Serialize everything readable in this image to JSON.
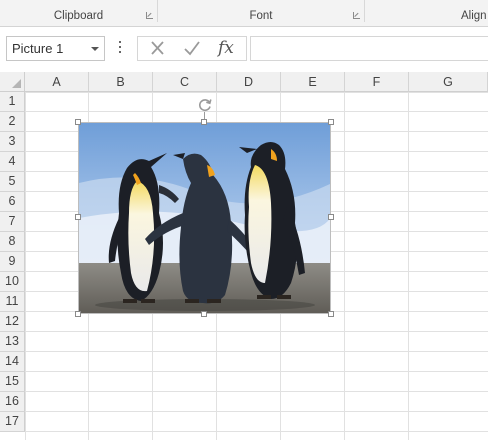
{
  "ribbon": {
    "groups": [
      {
        "label": "Clipboard"
      },
      {
        "label": "Font"
      },
      {
        "label": "Align"
      }
    ]
  },
  "formula_bar": {
    "name_box_value": "Picture 1",
    "cancel_icon": "close-icon",
    "enter_icon": "check-icon",
    "function_label": "fx",
    "formula_value": ""
  },
  "sheet": {
    "columns": [
      "A",
      "B",
      "C",
      "D",
      "E",
      "F",
      "G"
    ],
    "rows": [
      "1",
      "2",
      "3",
      "4",
      "5",
      "6",
      "7",
      "8",
      "9",
      "10",
      "11",
      "12",
      "13",
      "14",
      "15",
      "16",
      "17"
    ]
  },
  "picture": {
    "name": "Picture 1",
    "subject": "penguins-photo"
  },
  "colors": {
    "ribbon_bg": "#f3f3f3",
    "header_bg": "#f0f0f0",
    "gridline": "#e1e1e1"
  }
}
